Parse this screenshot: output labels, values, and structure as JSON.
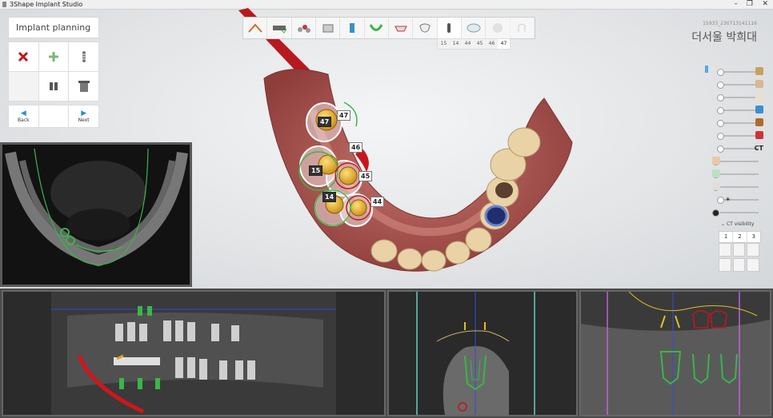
{
  "app": {
    "title": "3Shape Implant Studio"
  },
  "window": {
    "minimize": "–",
    "restore": "❐",
    "close": "✕"
  },
  "left_panel": {
    "title": "Implant planning",
    "tools": [
      "delete-implant",
      "add-implant",
      "implant",
      "",
      "abutment",
      "sleeve"
    ],
    "nav": {
      "back": "Back",
      "next": "Next"
    }
  },
  "toolbar": {
    "steps": [
      "home",
      "scan-alignment",
      "teeth",
      "panoramic",
      "implant-head",
      "arch",
      "crown-setup",
      "crown",
      "implant",
      "guide",
      "guide-3d",
      "export"
    ],
    "tooth_tabs": [
      "15",
      "14",
      "44",
      "45",
      "46",
      "47"
    ],
    "selected_tooth": "47"
  },
  "patient": {
    "id": "15933_230713141116",
    "name": "더서울 박희대"
  },
  "right_controls": {
    "ct_label": "CT",
    "ct_visibility": "CT visibility",
    "view_tabs": [
      "1",
      "2",
      "3"
    ]
  },
  "implant_labels": [
    {
      "tooth": "47"
    },
    {
      "tooth": "46"
    },
    {
      "tooth": "15"
    },
    {
      "tooth": "45"
    },
    {
      "tooth": "14"
    },
    {
      "tooth": "44"
    }
  ],
  "colors": {
    "accent": "#2a8fd0",
    "gum": "#b35a57",
    "implant": "#e0a020",
    "guide": "#3ab54a",
    "ct_line": "#2d4fd6"
  }
}
